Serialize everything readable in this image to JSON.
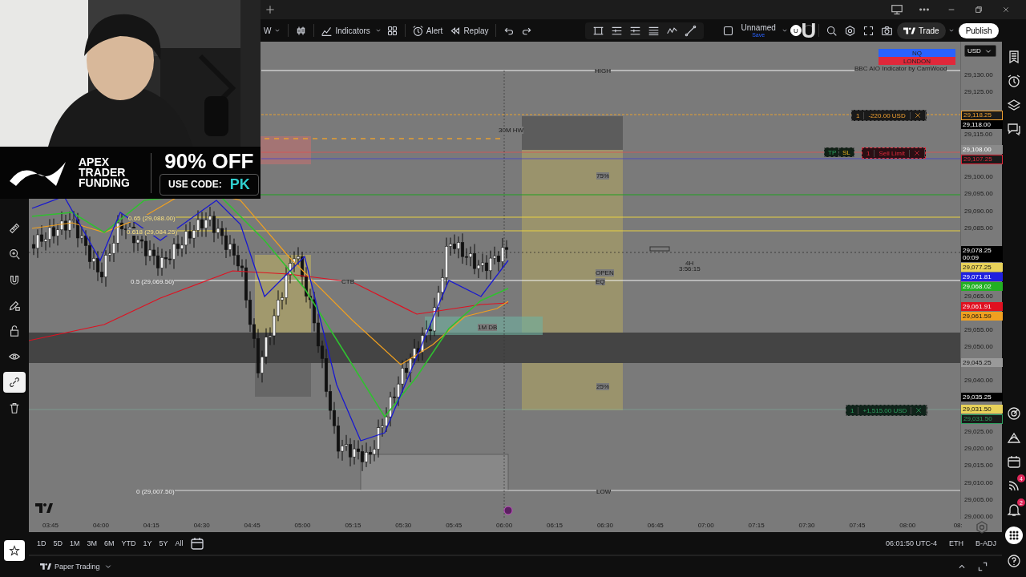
{
  "toolbar": {
    "interval": "W",
    "indicators": "Indicators",
    "alert": "Alert",
    "replay": "Replay",
    "layout_name": "Unnamed",
    "layout_status": "Save",
    "avatars": [
      {
        "letter": "U",
        "selected": true
      },
      {
        "letter": "U",
        "selected": false
      }
    ],
    "trade": "Trade",
    "publish": "Publish"
  },
  "left_tools": [
    {
      "kind": "ruler",
      "selected": false
    },
    {
      "kind": "zoom",
      "selected": false
    },
    {
      "kind": "magnet",
      "selected": false
    },
    {
      "kind": "pencil-lock",
      "selected": false
    },
    {
      "kind": "lock",
      "selected": false
    },
    {
      "kind": "eye",
      "selected": false
    },
    {
      "kind": "link",
      "selected": true
    },
    {
      "kind": "trash",
      "selected": false
    }
  ],
  "right_sidebar": [
    {
      "kind": "list"
    },
    {
      "kind": "alarm"
    },
    {
      "kind": "layers"
    },
    {
      "kind": "chat"
    },
    {
      "kind": "target"
    },
    {
      "kind": "mountain"
    },
    {
      "kind": "calendar"
    },
    {
      "kind": "feed",
      "badge": "4"
    },
    {
      "kind": "bell",
      "badge": "2"
    },
    {
      "kind": "grid"
    },
    {
      "kind": "help"
    }
  ],
  "legend": [
    {
      "label": "NQ",
      "color": "#2962ff"
    },
    {
      "label": "LONDON",
      "color": "#e0283a"
    }
  ],
  "indicator_name": "BBC AIO Indicator by CamWood",
  "chart_labels": [
    "HIGH",
    "30M HW",
    "75%",
    "0.65 (29,088.00)",
    "0.618 (29,084.25)",
    "0.5 (29,069.50)",
    "CTB",
    "OPEN",
    "EQ",
    "4H",
    "3:56:15",
    "1M DB",
    "25%",
    "0 (29,007.50)",
    "LOW"
  ],
  "orders": [
    {
      "kind": "loss",
      "qty": "1",
      "label": "-220.00 USD"
    },
    {
      "kind": "sell",
      "qty": "1",
      "label": "Sell Limit",
      "brackets": [
        "TP",
        "SL"
      ]
    },
    {
      "kind": "profit",
      "qty": "1",
      "label": "+1,515.00 USD"
    }
  ],
  "currency": "USD",
  "price_axis": [
    {
      "kind": "tick",
      "text": "29,130.00"
    },
    {
      "kind": "tick",
      "text": "29,125.00"
    },
    {
      "kind": "outlined",
      "text": "29,118.25",
      "color": "#f0a030"
    },
    {
      "kind": "filled",
      "text": "29,118.00",
      "color": "#000000"
    },
    {
      "kind": "tick",
      "text": "29,115.00"
    },
    {
      "kind": "filled",
      "text": "29,108.00",
      "color": "#8a8a8a"
    },
    {
      "kind": "outlined",
      "text": "29,107.25",
      "color": "#e0283a"
    },
    {
      "kind": "tick",
      "text": "29,100.00"
    },
    {
      "kind": "tick",
      "text": "29,095.00"
    },
    {
      "kind": "tick",
      "text": "29,090.00"
    },
    {
      "kind": "tick",
      "text": "29,085.00"
    },
    {
      "kind": "filled",
      "text": "29,078.25",
      "color": "#000000",
      "countdown": "00:09"
    },
    {
      "kind": "filled",
      "text": "29,077.25",
      "color": "#e8d25a"
    },
    {
      "kind": "filled",
      "text": "29,071.81",
      "color": "#2020e0"
    },
    {
      "kind": "filled",
      "text": "29,068.02",
      "color": "#22b022"
    },
    {
      "kind": "tick",
      "text": "29,065.00"
    },
    {
      "kind": "filled",
      "text": "29,061.91",
      "color": "#e01020"
    },
    {
      "kind": "filled",
      "text": "29,061.59",
      "color": "#f0a020"
    },
    {
      "kind": "tick",
      "text": "29,055.00"
    },
    {
      "kind": "tick",
      "text": "29,050.00"
    },
    {
      "kind": "filled",
      "text": "29,045.25",
      "color": "#9a9a9a"
    },
    {
      "kind": "tick",
      "text": "29,040.00"
    },
    {
      "kind": "filled",
      "text": "29,035.25",
      "color": "#000000"
    },
    {
      "kind": "filled",
      "text": "29,031.50",
      "color": "#e8d25a"
    },
    {
      "kind": "outlined",
      "text": "29,031.50",
      "color": "#2ea060"
    },
    {
      "kind": "tick",
      "text": "29,025.00"
    },
    {
      "kind": "tick",
      "text": "29,020.00"
    },
    {
      "kind": "tick",
      "text": "29,015.00"
    },
    {
      "kind": "tick",
      "text": "29,010.00"
    },
    {
      "kind": "tick",
      "text": "29,005.00"
    },
    {
      "kind": "tick",
      "text": "29,000.00"
    }
  ],
  "time_axis": [
    "03:45",
    "04:00",
    "04:15",
    "04:30",
    "04:45",
    "05:00",
    "05:15",
    "05:30",
    "05:45",
    "06:00",
    "06:15",
    "06:30",
    "06:45",
    "07:00",
    "07:15",
    "07:30",
    "07:45",
    "08:00",
    "08:"
  ],
  "ranges": [
    {
      "label": "1D"
    },
    {
      "label": "5D"
    },
    {
      "label": "1M"
    },
    {
      "label": "3M"
    },
    {
      "label": "6M"
    },
    {
      "label": "YTD"
    },
    {
      "label": "1Y"
    },
    {
      "label": "5Y"
    },
    {
      "label": "All"
    }
  ],
  "status": {
    "time": "06:01:50 UTC-4",
    "session": "ETH",
    "adjustment": "B-ADJ"
  },
  "panel": {
    "title": "Paper Trading"
  },
  "ad": {
    "brand": "APEX TRADER FUNDING",
    "offer": "90% OFF",
    "code_label": "USE CODE:",
    "code": "PK"
  }
}
